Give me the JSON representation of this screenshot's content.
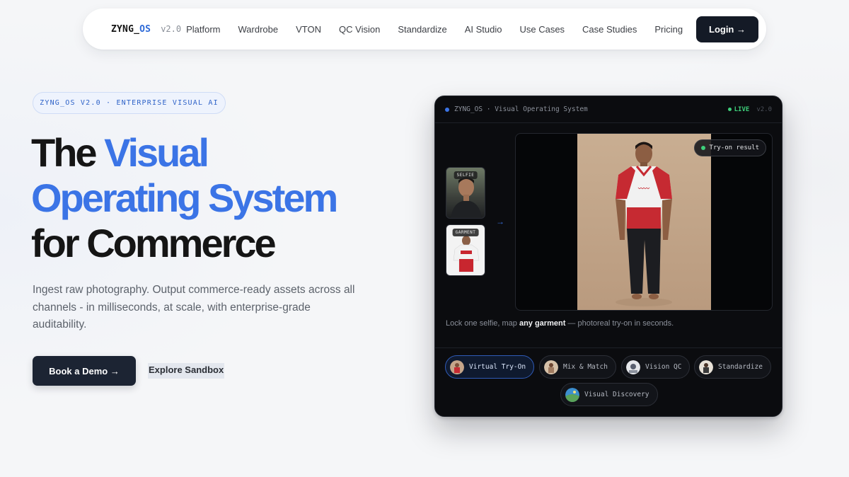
{
  "nav": {
    "brand_main": "ZYNG_",
    "brand_accent": "OS",
    "version": "v2.0",
    "links": [
      "Platform",
      "Wardrobe",
      "VTON",
      "QC Vision",
      "Standardize",
      "AI Studio",
      "Use Cases",
      "Case Studies",
      "Pricing"
    ],
    "login_label": "Login →"
  },
  "hero": {
    "badge": "ZYNG_OS V2.0 · ENTERPRISE VISUAL AI",
    "headline_1": "The ",
    "headline_2": "Visual",
    "headline_3": "Operating System",
    "headline_4": "for Commerce",
    "subtext": "Ingest raw photography. Output commerce-ready assets across all channels - in milliseconds, at scale, with enterprise-grade auditability.",
    "primary_cta": "Book a Demo →",
    "secondary_cta": "Explore Sandbox"
  },
  "panel": {
    "title": "ZYNG_OS · Visual Operating System",
    "live_label": "LIVE",
    "version": "v2.0",
    "selfie_label": "SELFIE",
    "garment_label": "GARMENT",
    "arrow": "→",
    "result_label": "Try-on result",
    "caption_pre": "Lock one selfie, map ",
    "caption_bold": "any garment",
    "caption_post": " — photoreal try-on in seconds.",
    "chips": [
      "Virtual Try-On",
      "Mix & Match",
      "Vision QC",
      "Standardize",
      "Visual Discovery"
    ]
  },
  "colors": {
    "accent_blue": "#3b74e6",
    "live_green": "#3ecf7a",
    "panel_bg": "#0b0c0f",
    "dark_button": "#141a26"
  }
}
